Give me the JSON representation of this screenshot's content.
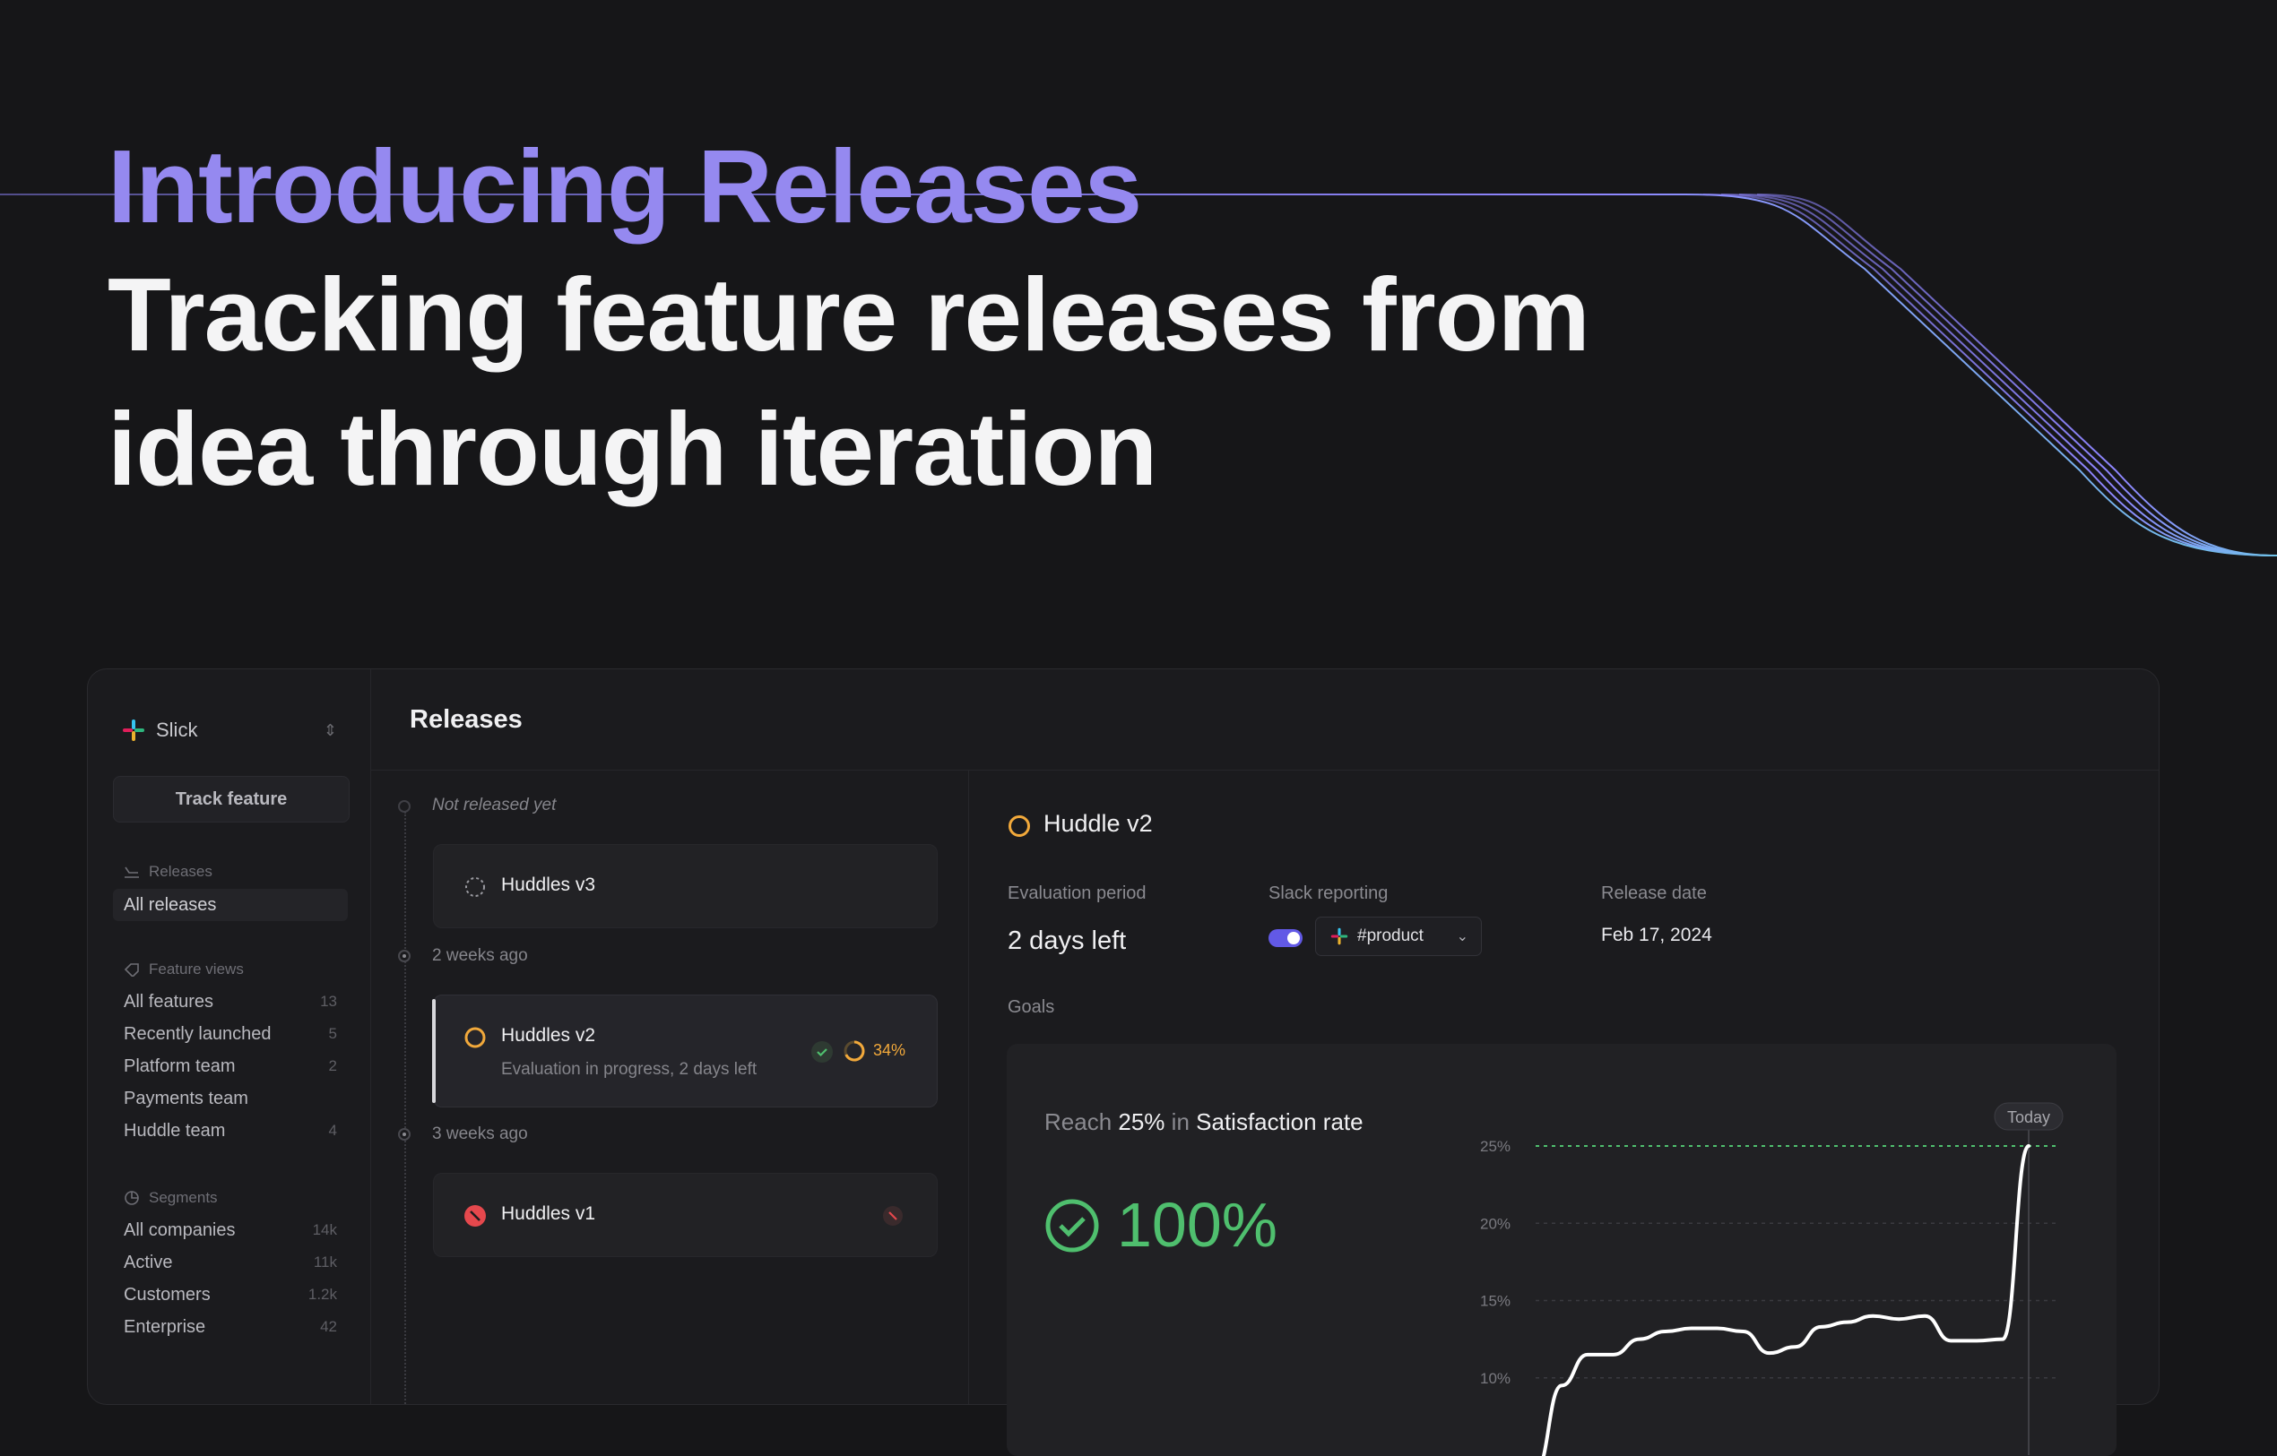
{
  "hero": {
    "eyebrow": "Introducing Releases",
    "title": "Tracking feature releases from idea through iteration"
  },
  "colors": {
    "accent": "#9589f0",
    "success": "#4fbf6e",
    "warning": "#f2a93b",
    "danger": "#e5484d",
    "toggle": "#6259e6",
    "hero_line_start": "#8f86ff",
    "hero_line_end": "#6fc3e8"
  },
  "sidebar": {
    "workspace": "Slick",
    "workspace_icon": "slack-logo-icon",
    "track_button": "Track feature",
    "releases_section": "Releases",
    "releases_items": [
      {
        "label": "All releases",
        "active": true
      }
    ],
    "feature_views_section": "Feature views",
    "feature_views": [
      {
        "label": "All features",
        "count": "13"
      },
      {
        "label": "Recently launched",
        "count": "5"
      },
      {
        "label": "Platform team",
        "count": "2"
      },
      {
        "label": "Payments team",
        "count": ""
      },
      {
        "label": "Huddle team",
        "count": "4"
      }
    ],
    "segments_section": "Segments",
    "segments": [
      {
        "label": "All companies",
        "count": "14k"
      },
      {
        "label": "Active",
        "count": "11k"
      },
      {
        "label": "Customers",
        "count": "1.2k"
      },
      {
        "label": "Enterprise",
        "count": "42"
      }
    ]
  },
  "main": {
    "title": "Releases",
    "groups": [
      {
        "label": "Not released yet",
        "items": [
          {
            "title": "Huddles v3",
            "status_icon": "dashed-circle-icon"
          }
        ]
      },
      {
        "label": "2 weeks ago",
        "items": [
          {
            "title": "Huddles v2",
            "subtitle": "Evaluation in progress, 2 days left",
            "status_icon": "in-progress-circle-icon",
            "progress": "34%",
            "selected": true
          }
        ]
      },
      {
        "label": "3 weeks ago",
        "items": [
          {
            "title": "Huddles v1",
            "status_icon": "cancelled-icon"
          }
        ]
      }
    ]
  },
  "detail": {
    "title": "Huddle v2",
    "evaluation_label": "Evaluation period",
    "evaluation_value": "2 days left",
    "slack_label": "Slack reporting",
    "slack_enabled": true,
    "slack_channel": "#product",
    "release_label": "Release date",
    "release_value": "Feb 17, 2024",
    "goals_label": "Goals",
    "goal": {
      "prefix": "Reach",
      "target": "25%",
      "mid": "in",
      "metric": "Satisfaction rate",
      "result": "100%"
    }
  },
  "chart_data": {
    "type": "line",
    "title": "",
    "xlabel": "",
    "ylabel": "",
    "y_ticks": [
      "25%",
      "20%",
      "15%",
      "10%"
    ],
    "ylim": [
      5,
      25
    ],
    "target": 25,
    "marker_label": "Today",
    "series": [
      {
        "values": [
          4.0,
          9.5,
          11.5,
          11.5,
          12.5,
          13.0,
          13.2,
          13.2,
          13.0,
          11.6,
          12.0,
          13.3,
          13.6,
          14.0,
          13.8,
          14.0,
          12.4,
          12.4,
          12.5,
          25.0
        ]
      }
    ]
  }
}
